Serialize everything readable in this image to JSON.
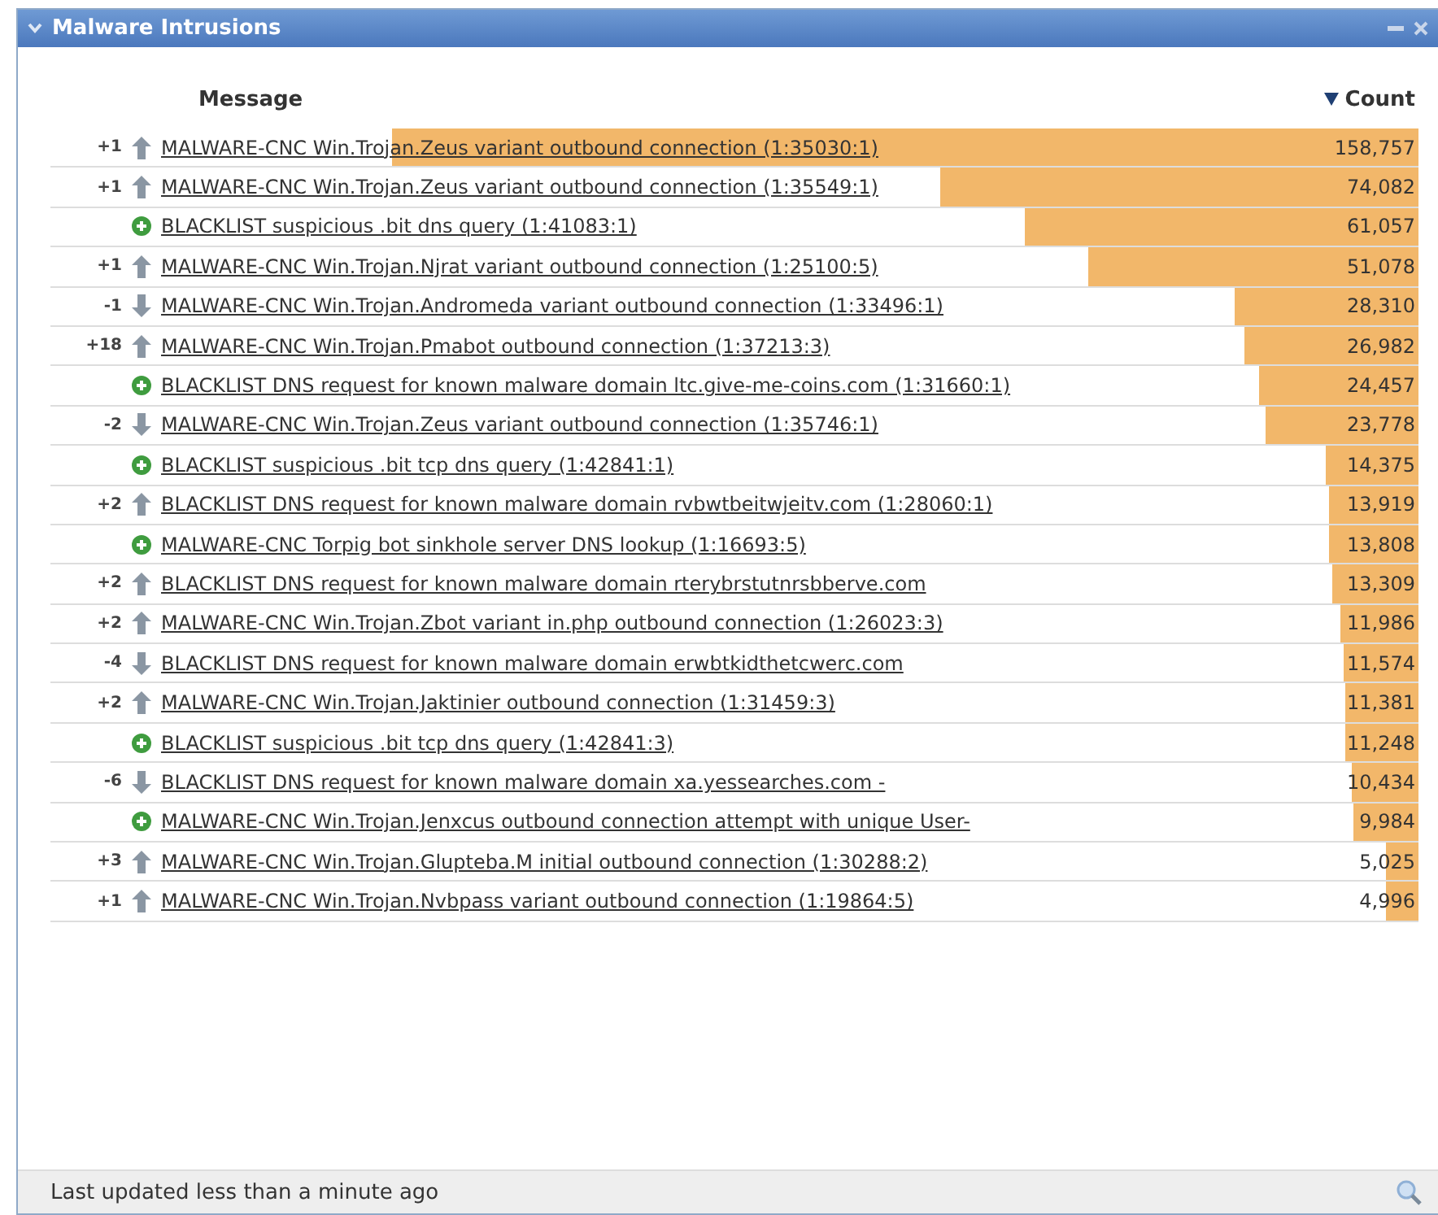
{
  "panel": {
    "title": "Malware Intrusions",
    "expanded": true
  },
  "columns": {
    "message": "Message",
    "count": "Count",
    "sorted_descending": true
  },
  "rows": [
    {
      "change": "+1",
      "kind": "up",
      "message": "MALWARE-CNC Win.Trojan.Zeus variant outbound connection (1:35030:1)",
      "count": "158,757",
      "level": 0.75
    },
    {
      "change": "+1",
      "kind": "up",
      "message": "MALWARE-CNC Win.Trojan.Zeus variant outbound connection (1:35549:1)",
      "count": "74,082",
      "level": 0.35
    },
    {
      "change": "",
      "kind": "new",
      "message": "BLACKLIST suspicious .bit dns query (1:41083:1)",
      "count": "61,057",
      "level": 0.288
    },
    {
      "change": "+1",
      "kind": "up",
      "message": "MALWARE-CNC Win.Trojan.Njrat variant outbound connection (1:25100:5)",
      "count": "51,078",
      "level": 0.241
    },
    {
      "change": "-1",
      "kind": "down",
      "message": "MALWARE-CNC Win.Trojan.Andromeda variant outbound connection (1:33496:1)",
      "count": "28,310",
      "level": 0.134
    },
    {
      "change": "+18",
      "kind": "up",
      "message": "MALWARE-CNC Win.Trojan.Pmabot outbound connection (1:37213:3)",
      "count": "26,982",
      "level": 0.127
    },
    {
      "change": "",
      "kind": "new",
      "message": "BLACKLIST DNS request for known malware domain ltc.give-me-coins.com (1:31660:1)",
      "count": "24,457",
      "level": 0.116
    },
    {
      "change": "-2",
      "kind": "down",
      "message": "MALWARE-CNC Win.Trojan.Zeus variant outbound connection (1:35746:1)",
      "count": "23,778",
      "level": 0.112
    },
    {
      "change": "",
      "kind": "new",
      "message": "BLACKLIST suspicious .bit tcp dns query (1:42841:1)",
      "count": "14,375",
      "level": 0.068
    },
    {
      "change": "+2",
      "kind": "up",
      "message": "BLACKLIST DNS request for known malware domain rvbwtbeitwjeitv.com (1:28060:1)",
      "count": "13,919",
      "level": 0.066
    },
    {
      "change": "",
      "kind": "new",
      "message": "MALWARE-CNC Torpig bot sinkhole server DNS lookup (1:16693:5)",
      "count": "13,808",
      "level": 0.065
    },
    {
      "change": "+2",
      "kind": "up",
      "message": "BLACKLIST DNS request for known malware domain rterybrstutnrsbberve.com",
      "count": "13,309",
      "level": 0.063
    },
    {
      "change": "+2",
      "kind": "up",
      "message": "MALWARE-CNC Win.Trojan.Zbot variant in.php outbound connection (1:26023:3)",
      "count": "11,986",
      "level": 0.057
    },
    {
      "change": "-4",
      "kind": "down",
      "message": "BLACKLIST DNS request for known malware domain erwbtkidthetcwerc.com",
      "count": "11,574",
      "level": 0.055
    },
    {
      "change": "+2",
      "kind": "up",
      "message": "MALWARE-CNC Win.Trojan.Jaktinier outbound connection (1:31459:3)",
      "count": "11,381",
      "level": 0.054
    },
    {
      "change": "",
      "kind": "new",
      "message": "BLACKLIST suspicious .bit tcp dns query (1:42841:3)",
      "count": "11,248",
      "level": 0.053
    },
    {
      "change": "-6",
      "kind": "down",
      "message": "BLACKLIST DNS request for known malware domain xa.yessearches.com -",
      "count": "10,434",
      "level": 0.049
    },
    {
      "change": "",
      "kind": "new",
      "message": "MALWARE-CNC Win.Trojan.Jenxcus outbound connection attempt with unique User-",
      "count": "9,984",
      "level": 0.047
    },
    {
      "change": "+3",
      "kind": "up",
      "message": "MALWARE-CNC Win.Trojan.Glupteba.M initial outbound connection (1:30288:2)",
      "count": "5,025",
      "level": 0.024
    },
    {
      "change": "+1",
      "kind": "up",
      "message": "MALWARE-CNC Win.Trojan.Nvbpass variant outbound connection (1:19864:5)",
      "count": "4,996",
      "level": 0.024
    }
  ],
  "footer": {
    "text": "Last updated less than a minute ago"
  }
}
